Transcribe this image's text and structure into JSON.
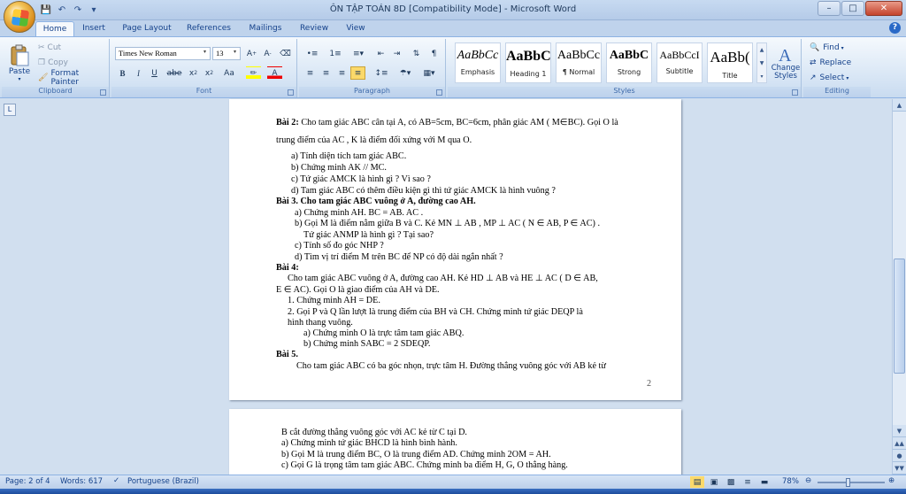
{
  "window": {
    "title": "ÔN TẬP TOÁN 8D [Compatibility Mode] - Microsoft Word"
  },
  "tabs": [
    "Home",
    "Insert",
    "Page Layout",
    "References",
    "Mailings",
    "Review",
    "View"
  ],
  "clipboard": {
    "paste": "Paste",
    "cut": "Cut",
    "copy": "Copy",
    "format_painter": "Format Painter",
    "label": "Clipboard"
  },
  "font": {
    "name": "Times New Roman",
    "size": "13",
    "label": "Font"
  },
  "paragraph": {
    "label": "Paragraph"
  },
  "styles": {
    "items": [
      {
        "sample": "AaBbCc",
        "name": "Emphasis"
      },
      {
        "sample": "AaBbC",
        "name": "Heading 1"
      },
      {
        "sample": "AaBbCc",
        "name": "¶ Normal"
      },
      {
        "sample": "AaBbC",
        "name": "Strong"
      },
      {
        "sample": "AaBbCcI",
        "name": "Subtitle"
      },
      {
        "sample": "AaBb(",
        "name": "Title"
      }
    ],
    "change_styles": "Change Styles",
    "label": "Styles"
  },
  "editing": {
    "find": "Find",
    "replace": "Replace",
    "select": "Select",
    "label": "Editing"
  },
  "page1": {
    "lines": [
      "Bài 2: Cho tam giác ABC cân tại A, có AB=5cm, BC=6cm, phân giác AM ( M∈BC). Gọi O là",
      "trung điểm của AC , K là điểm đối xứng với M qua O.",
      "a)  Tính diện tích tam giác ABC.",
      "b)  Chứng minh AK // MC.",
      "c)  Tứ giác AMCK là hình gì ? Vì sao ?",
      "d)  Tam giác ABC có thêm điều kiện gì thì tứ giác AMCK là hình vuông ?",
      "Bài 3.     Cho tam giác ABC vuông ở A, đường cao AH.",
      "a) Chứng minh AH. BC = AB. AC .",
      "b) Gọi M là điểm nằm giữa B và C. Kẻ MN ⊥ AB , MP ⊥ AC ( N ∈ AB, P ∈ AC) .",
      "Tứ giác ANMP là hình gì ? Tại sao?",
      "c) Tính số đo góc NHP ?",
      "d) Tìm vị trí điểm M trên BC để NP có độ dài ngắn nhất ?",
      "Bài 4:",
      "Cho tam giác ABC vuông ở A, đường cao AH. Kẻ HD ⊥ AB và  HE ⊥ AC ( D ∈ AB,",
      "E ∈ AC). Gọi O là giao điểm của AH và DE.",
      "1. Chứng minh AH = DE.",
      "2. Gọi P và Q lần lượt là trung điểm của BH và CH. Chứng minh tứ giác DEQP là",
      "hình thang vuông.",
      "a)  Chứng minh O là trực tâm tam giác ABQ.",
      "b)  Chứng minh SABC = 2 SDEQP.",
      "Bài 5.",
      "Cho tam giác ABC có ba góc nhọn, trực tâm H. Đường thẳng vuông góc với AB kẻ từ"
    ],
    "page_number": "2"
  },
  "page2": {
    "lines": [
      "B cắt đường thẳng vuông góc với AC kẻ từ C tại D.",
      "a) Chứng minh tứ giác BHCD là hình bình hành.",
      "b) Gọi M là trung điểm BC, O là trung điểm AD. Chứng minh 2OM = AH.",
      "c) Gọi G là trọng tâm tam giác ABC. Chứng minh ba điểm H, G, O thẳng hàng."
    ]
  },
  "status": {
    "page": "Page: 2 of 4",
    "words": "Words: 617",
    "language": "Portuguese (Brazil)",
    "zoom": "78%"
  }
}
